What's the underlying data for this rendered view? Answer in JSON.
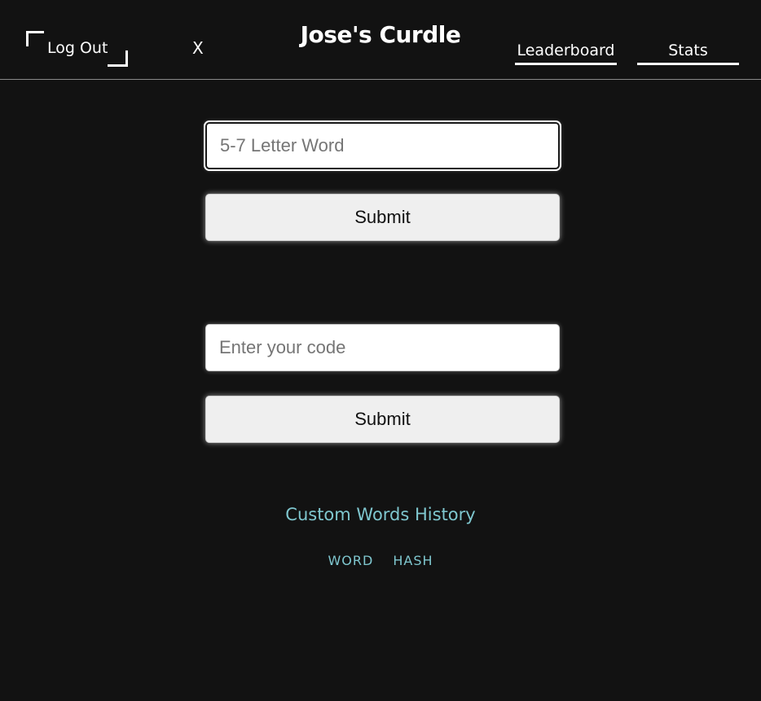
{
  "header": {
    "logout_label": "Log Out",
    "close_label": "X",
    "title": "Jose's Curdle",
    "nav": {
      "leaderboard": "Leaderboard",
      "stats": "Stats"
    }
  },
  "custom_word": {
    "value": "",
    "placeholder": "5-7 Letter Word",
    "submit_label": "Submit"
  },
  "code_entry": {
    "value": "",
    "placeholder": "Enter your code",
    "submit_label": "Submit"
  },
  "history": {
    "link_label": "Custom Words History",
    "columns": [
      "WORD",
      "HASH"
    ]
  },
  "colors": {
    "background": "#121212",
    "accent_link": "#7fc7cf",
    "button_bg": "#efefef"
  }
}
